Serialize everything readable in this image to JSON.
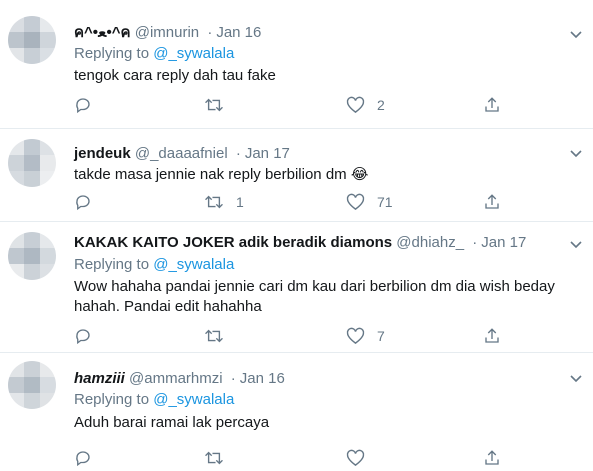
{
  "tweets": [
    {
      "name": "ค^•ﻌ•^ค",
      "handle": "@imnurin",
      "dot": "·",
      "date": "Jan 16",
      "replying_prefix": "Replying to",
      "replying_to": "@_sywalala",
      "text": "tengok cara reply dah tau fake",
      "reply_count": "",
      "retweet_count": "",
      "like_count": "2",
      "avatar_colors": [
        "#d9dde2",
        "#c5ccd4",
        "#e6e9ec",
        "#bcc4cc",
        "#a9b3bd",
        "#cfd5db",
        "#e2e5e8",
        "#c8cfd6",
        "#dadfe4"
      ]
    },
    {
      "name": "jendeuk",
      "handle": "@_daaaafniel",
      "dot": "·",
      "date": "Jan 17",
      "replying_prefix": "",
      "replying_to": "",
      "text": "takde masa jennie nak reply berbilion dm 😂",
      "reply_count": "",
      "retweet_count": "1",
      "like_count": "71",
      "avatar_colors": [
        "#e4e7ea",
        "#c2cad2",
        "#dde1e5",
        "#cdd3d9",
        "#b3bcc6",
        "#e8eaec",
        "#d6dbe0",
        "#c9d0d6",
        "#eceef0"
      ]
    },
    {
      "name": "KAKAK KAITO JOKER adik beradik diamons",
      "handle": "@dhiahz_",
      "dot": "·",
      "date": "Jan 17",
      "replying_prefix": "Replying to",
      "replying_to": "@_sywalala",
      "text": "Wow hahaha pandai jennie cari dm kau dari berbilion dm dia wish beday hahah. Pandai edit hahahha",
      "reply_count": "",
      "retweet_count": "",
      "like_count": "7",
      "avatar_colors": [
        "#dfe3e6",
        "#c7ced5",
        "#e5e8eb",
        "#bfc7cf",
        "#aeb8c2",
        "#d3d9de",
        "#e9ebed",
        "#ccd2d8",
        "#dce0e4"
      ]
    },
    {
      "name": "hamziii",
      "handle": "@ammarhmzi",
      "dot": "·",
      "date": "Jan 16",
      "replying_prefix": "Replying to",
      "replying_to": "@_sywalala",
      "text": "Aduh barai ramai lak percaya",
      "reply_count": "",
      "retweet_count": "",
      "like_count": "",
      "avatar_colors": [
        "#e1e4e7",
        "#cbd1d7",
        "#e7e9eb",
        "#c3cad1",
        "#b1bbc4",
        "#d7dce1",
        "#e3e6e9",
        "#cfd5da",
        "#dfe2e5"
      ]
    }
  ]
}
